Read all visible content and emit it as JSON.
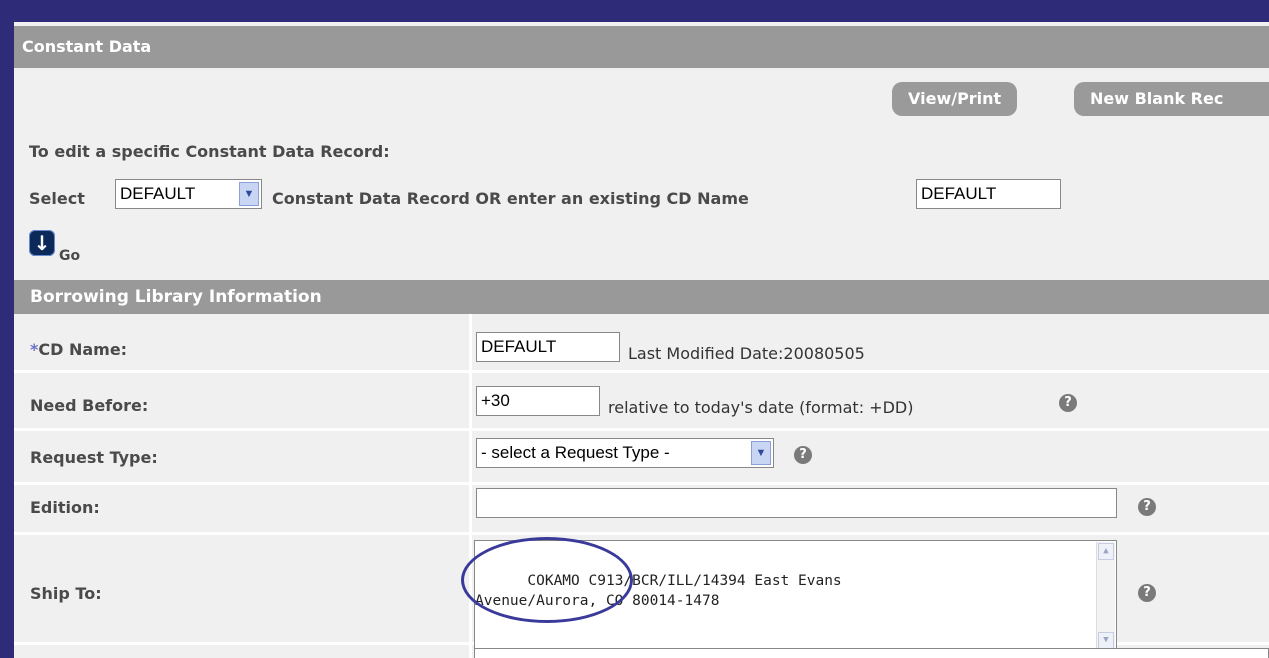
{
  "constant_data": {
    "header": "Constant Data",
    "view_print_label": "View/Print",
    "new_blank_label": "New Blank Rec",
    "edit_instruction": "To edit a specific Constant Data Record:",
    "select_label": "Select",
    "selected_record": "DEFAULT",
    "or_label": "Constant Data Record OR enter an existing CD Name",
    "cd_name_value": "DEFAULT",
    "go_label": "Go"
  },
  "borrowing": {
    "header": "Borrowing Library Information",
    "cd_name": {
      "required_marker": "*",
      "label": "CD Name:",
      "value": "DEFAULT",
      "last_modified": "Last Modified Date:20080505"
    },
    "need_before": {
      "label": "Need Before:",
      "value": "+30",
      "hint": "relative to today's date (format: +DD)"
    },
    "request_type": {
      "label": "Request Type:",
      "selected": "- select a Request Type -"
    },
    "edition": {
      "label": "Edition:",
      "value": ""
    },
    "ship_to": {
      "label": "Ship To:",
      "value": "COKAMO C913/BCR/ILL/14394 East Evans\nAvenue/Aurora, CO 80014-1478"
    }
  },
  "icons": {
    "go": "arrow-down-icon",
    "help": "question-icon",
    "dropdown": "chevron-down-icon"
  },
  "colors": {
    "frame": "#2e2c78",
    "panel": "#f0f0f0",
    "header": "#999999",
    "required": "#6a73c8"
  }
}
